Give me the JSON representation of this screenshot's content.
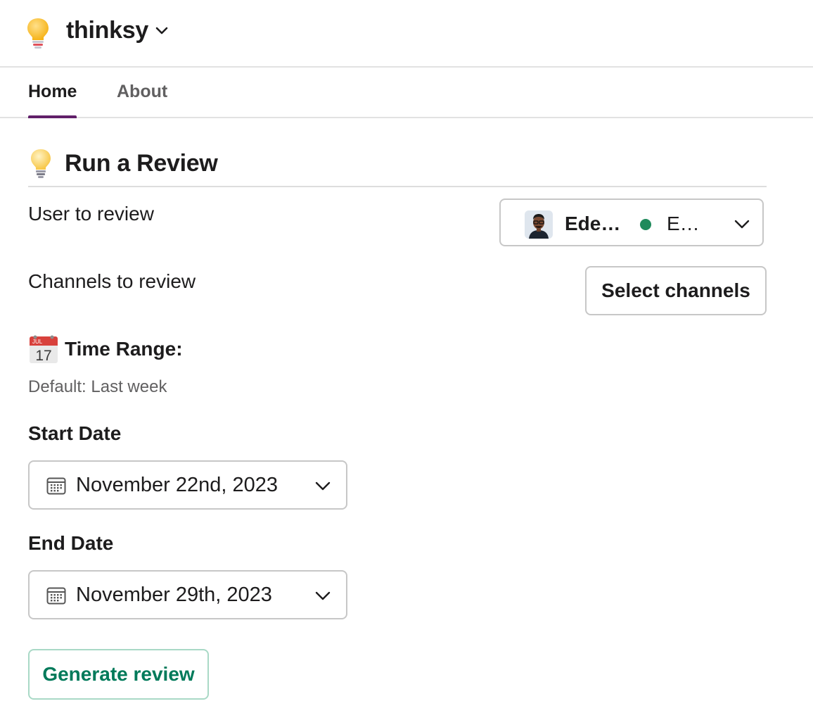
{
  "header": {
    "app_name": "thinksy",
    "app_icon": "lightbulb-icon",
    "menu_icon": "chevron-down-icon"
  },
  "tabs": [
    {
      "label": "Home",
      "active": true
    },
    {
      "label": "About",
      "active": false
    }
  ],
  "review": {
    "heading_icon": "lightbulb-icon",
    "heading": "Run a Review",
    "user_label": "User to review",
    "user_select": {
      "name": "Ede…",
      "status": "E…",
      "presence_color": "#1f8a5b"
    },
    "channels_label": "Channels to review",
    "channels_button": "Select channels",
    "time_range_icon": "calendar-emoji-icon",
    "time_range_title": "Time Range:",
    "time_range_default": "Default: Last week",
    "start_date_label": "Start Date",
    "start_date_value": "November 22nd, 2023",
    "end_date_label": "End Date",
    "end_date_value": "November 29th, 2023",
    "generate_button": "Generate review"
  },
  "colors": {
    "tab_underline": "#611f69",
    "primary_green": "#007a5a",
    "border": "#c7c7c7"
  }
}
